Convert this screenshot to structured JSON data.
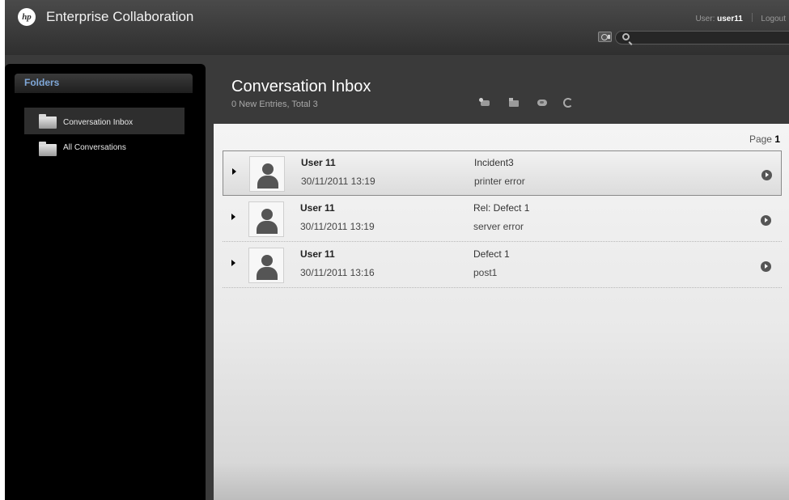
{
  "header": {
    "logo_text": "hp",
    "app_title": "Enterprise Collaboration",
    "user_prefix": "User:",
    "username": "user11",
    "logout_label": "Logout",
    "search_placeholder": "",
    "icons": [
      "photo-icon",
      "search-icon"
    ]
  },
  "sidebar": {
    "title": "Folders",
    "items": [
      {
        "label": "Conversation Inbox",
        "icon": "folder-icon",
        "active": true
      },
      {
        "label": "All Conversations",
        "icon": "folder-icon",
        "active": false
      }
    ]
  },
  "main": {
    "title": "Conversation Inbox",
    "subtitle": "0 New Entries, Total 3",
    "toolbar_icons": [
      "new-conversation-icon",
      "move-icon",
      "tag-icon",
      "refresh-icon"
    ],
    "paging": {
      "label": "Page",
      "number": "1"
    },
    "conversations": [
      {
        "author": "User 11",
        "date": "30/11/2011 13:19",
        "subject": "Incident3",
        "preview": "printer error",
        "selected": true
      },
      {
        "author": "User 11",
        "date": "30/11/2011 13:19",
        "subject": "Rel: Defect 1",
        "preview": "server error",
        "selected": false
      },
      {
        "author": "User 11",
        "date": "30/11/2011 13:16",
        "subject": "Defect 1",
        "preview": "post1",
        "selected": false
      }
    ]
  }
}
